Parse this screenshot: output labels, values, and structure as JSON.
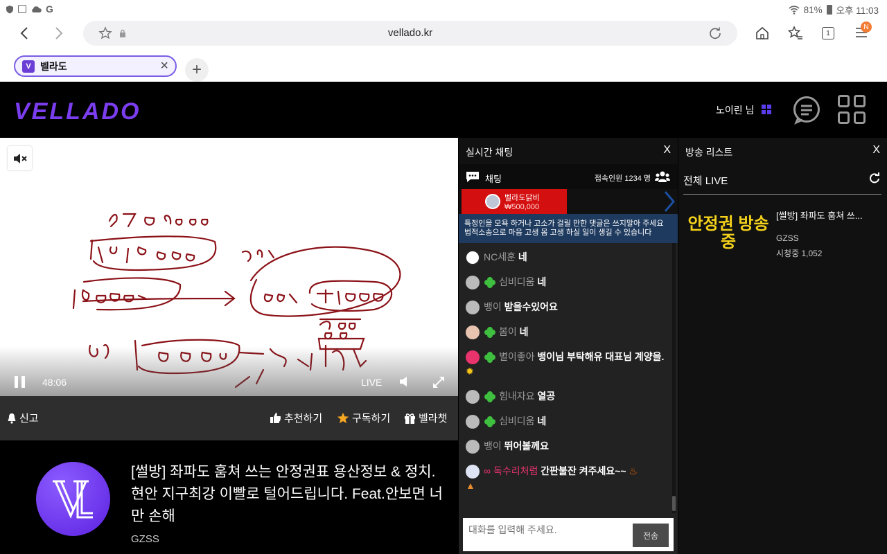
{
  "status_bar": {
    "battery": "81%",
    "time": "오후 11:03"
  },
  "browser": {
    "url": "vellado.kr",
    "tab_title": "벨라도",
    "tab_icon_letter": "V",
    "menu_badge": "N"
  },
  "site": {
    "logo": "VELLADO",
    "username": "노이린 님"
  },
  "player": {
    "time": "48:06",
    "live_label": "LIVE"
  },
  "actions": {
    "report": "신고",
    "recommend": "추천하기",
    "subscribe": "구독하기",
    "vellachat": "벨라챗"
  },
  "stream": {
    "title": "[썰방] 좌파도 훔쳐 쓰는 안정권표 용산정보 & 정치. 현안 지구최강 이빨로 털어드립니다. Feat.안보면 너만 손해",
    "streamer": "GZSS"
  },
  "chat": {
    "header": "실시간 채팅",
    "close": "X",
    "tab_label": "채팅",
    "viewers": "접속인원 1234 명",
    "donation_name": "벨라도닭비",
    "donation_amount": "₩500,000",
    "notice": "특정인을 모욕 하거나 고소가 걸릴 만한 댓글은 쓰지말아 주세요 법적소송으로 마음 고생 몸 고생 하실 일이 생길 수 있습니다",
    "messages": [
      {
        "nick": "NC세훈",
        "text": "네"
      },
      {
        "nick": "심비디움",
        "text": "네"
      },
      {
        "nick": "뱅이",
        "text": "받을수있어요"
      },
      {
        "nick": "봄이",
        "text": "네"
      },
      {
        "nick": "별이좋아",
        "text": "뱅이님 부탁해유 대표님 계양을. "
      },
      {
        "nick": "힘내자요",
        "text": "열공"
      },
      {
        "nick": "심비디움",
        "text": "네"
      },
      {
        "nick": "뱅이",
        "text": "뛰어볼께요"
      },
      {
        "nick": "독수리처럼",
        "text": "간판불잔 켜주세요~~ "
      }
    ],
    "input_placeholder": "대화를 입력해 주세요.",
    "send": "전송"
  },
  "broadcast_list": {
    "header": "방송 리스트",
    "close": "X",
    "tab": "전체 LIVE",
    "items": [
      {
        "thumb_text": "안정권 방송중",
        "title": "[썰방] 좌파도 훔쳐 쓰...",
        "streamer": "GZSS",
        "viewers": "시청중 1,052"
      }
    ]
  },
  "colors": {
    "brand_purple": "#7b3df0",
    "donation_red": "#d40f0f",
    "notice_blue": "#1e3a5e",
    "highlight_nick": "#e8336d",
    "thumb_yellow": "#f4d21c"
  }
}
